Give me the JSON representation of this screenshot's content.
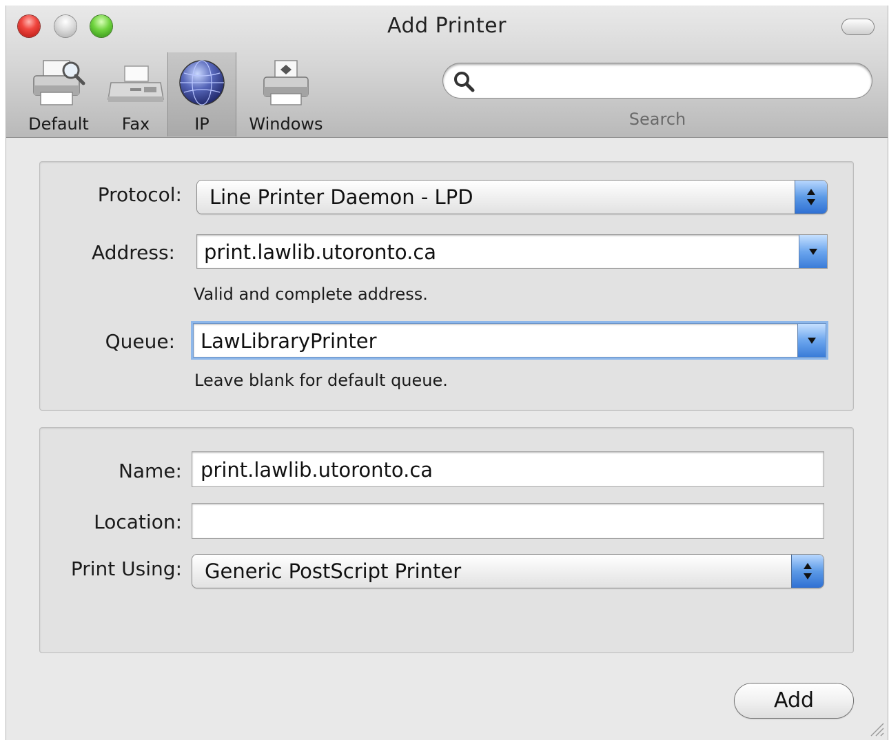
{
  "window": {
    "title": "Add Printer"
  },
  "toolbar": {
    "items": [
      {
        "label": "Default",
        "icon": "default-printer-icon"
      },
      {
        "label": "Fax",
        "icon": "fax-icon"
      },
      {
        "label": "IP",
        "icon": "ip-globe-icon",
        "selected": true
      },
      {
        "label": "Windows",
        "icon": "windows-printer-icon"
      }
    ],
    "search": {
      "label": "Search",
      "value": "",
      "placeholder": ""
    }
  },
  "connection": {
    "protocol": {
      "label": "Protocol:",
      "value": "Line Printer Daemon - LPD"
    },
    "address": {
      "label": "Address:",
      "value": "print.lawlib.utoronto.ca",
      "hint": "Valid and complete address."
    },
    "queue": {
      "label": "Queue:",
      "value": "LawLibraryPrinter",
      "hint": "Leave blank for default queue."
    }
  },
  "details": {
    "name": {
      "label": "Name:",
      "value": "print.lawlib.utoronto.ca"
    },
    "location": {
      "label": "Location:",
      "value": ""
    },
    "print_using": {
      "label": "Print Using:",
      "value": "Generic PostScript Printer"
    }
  },
  "actions": {
    "add_label": "Add"
  },
  "colors": {
    "accent": "#3a7cd8",
    "focus_ring": "#8db7ea"
  }
}
